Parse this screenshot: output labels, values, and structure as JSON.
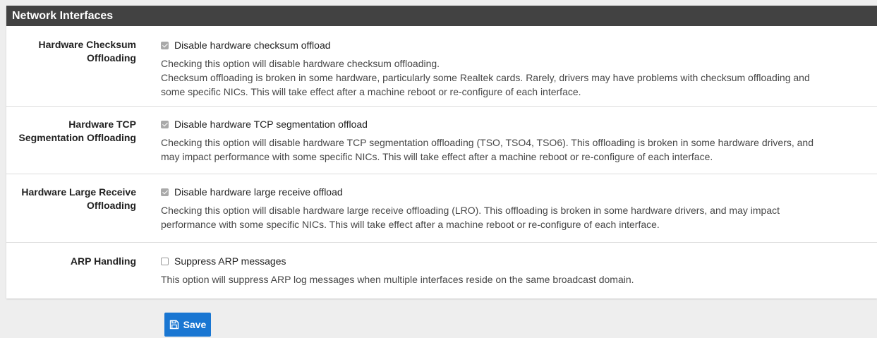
{
  "panel": {
    "title": "Network Interfaces"
  },
  "rows": [
    {
      "label_line1": "Hardware Checksum",
      "label_line2": "Offloading",
      "checkbox_label": "Disable hardware checksum offload",
      "checked": true,
      "help_line1": "Checking this option will disable hardware checksum offloading.",
      "help_line2": "Checksum offloading is broken in some hardware, particularly some Realtek cards. Rarely, drivers may have problems with checksum offloading and",
      "help_line3": "some specific NICs. This will take effect after a machine reboot or re-configure of each interface."
    },
    {
      "label_line1": "Hardware TCP",
      "label_line2": "Segmentation Offloading",
      "checkbox_label": "Disable hardware TCP segmentation offload",
      "checked": true,
      "help_line1": "Checking this option will disable hardware TCP segmentation offloading (TSO, TSO4, TSO6). This offloading is broken in some hardware drivers, and",
      "help_line2": "may impact performance with some specific NICs. This will take effect after a machine reboot or re-configure of each interface."
    },
    {
      "label_line1": "Hardware Large Receive",
      "label_line2": "Offloading",
      "checkbox_label": "Disable hardware large receive offload",
      "checked": true,
      "help_line1": "Checking this option will disable hardware large receive offloading (LRO). This offloading is broken in some hardware drivers, and may impact",
      "help_line2": "performance with some specific NICs. This will take effect after a machine reboot or re-configure of each interface."
    },
    {
      "label_line1": "ARP Handling",
      "checkbox_label": "Suppress ARP messages",
      "checked": false,
      "help_line1": "This option will suppress ARP log messages when multiple interfaces reside on the same broadcast domain."
    }
  ],
  "save_button": {
    "label": "Save",
    "icon": "save-icon"
  },
  "colors": {
    "heading_bg": "#424242",
    "button_bg": "#1976d2",
    "page_bg": "#eeeeee"
  }
}
